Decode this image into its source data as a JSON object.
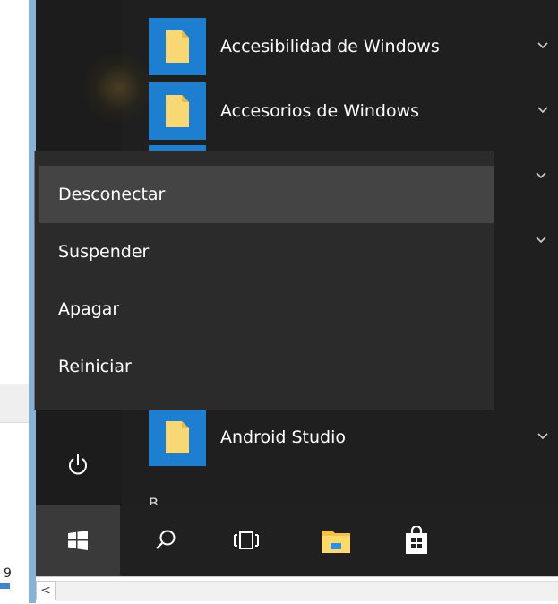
{
  "start_menu": {
    "apps": [
      {
        "label": "Accesibilidad de Windows"
      },
      {
        "label": "Accesorios de Windows"
      },
      {
        "label": "Android Studio"
      }
    ],
    "section_letter": "B"
  },
  "power_menu": {
    "items": [
      {
        "label": "Desconectar"
      },
      {
        "label": "Suspender"
      },
      {
        "label": "Apagar"
      },
      {
        "label": "Reiniciar"
      }
    ]
  },
  "desktop": {
    "partial_digit": "9"
  },
  "bottom_strip": {
    "scroll_left_glyph": "<"
  },
  "colors": {
    "tile_blue": "#1e7fd0",
    "menu_bg": "#1f1f1f",
    "submenu_bg": "#2b2b2b",
    "submenu_hover": "#444444",
    "taskbar_bg": "#202020",
    "folder_yellow": "#f8d775"
  },
  "icons": {
    "power": "power-icon",
    "start": "windows-logo-icon",
    "search": "search-icon",
    "task_view": "task-view-icon",
    "explorer": "file-explorer-icon",
    "store": "store-icon",
    "folder": "folder-icon",
    "chevron": "chevron-down-icon"
  }
}
